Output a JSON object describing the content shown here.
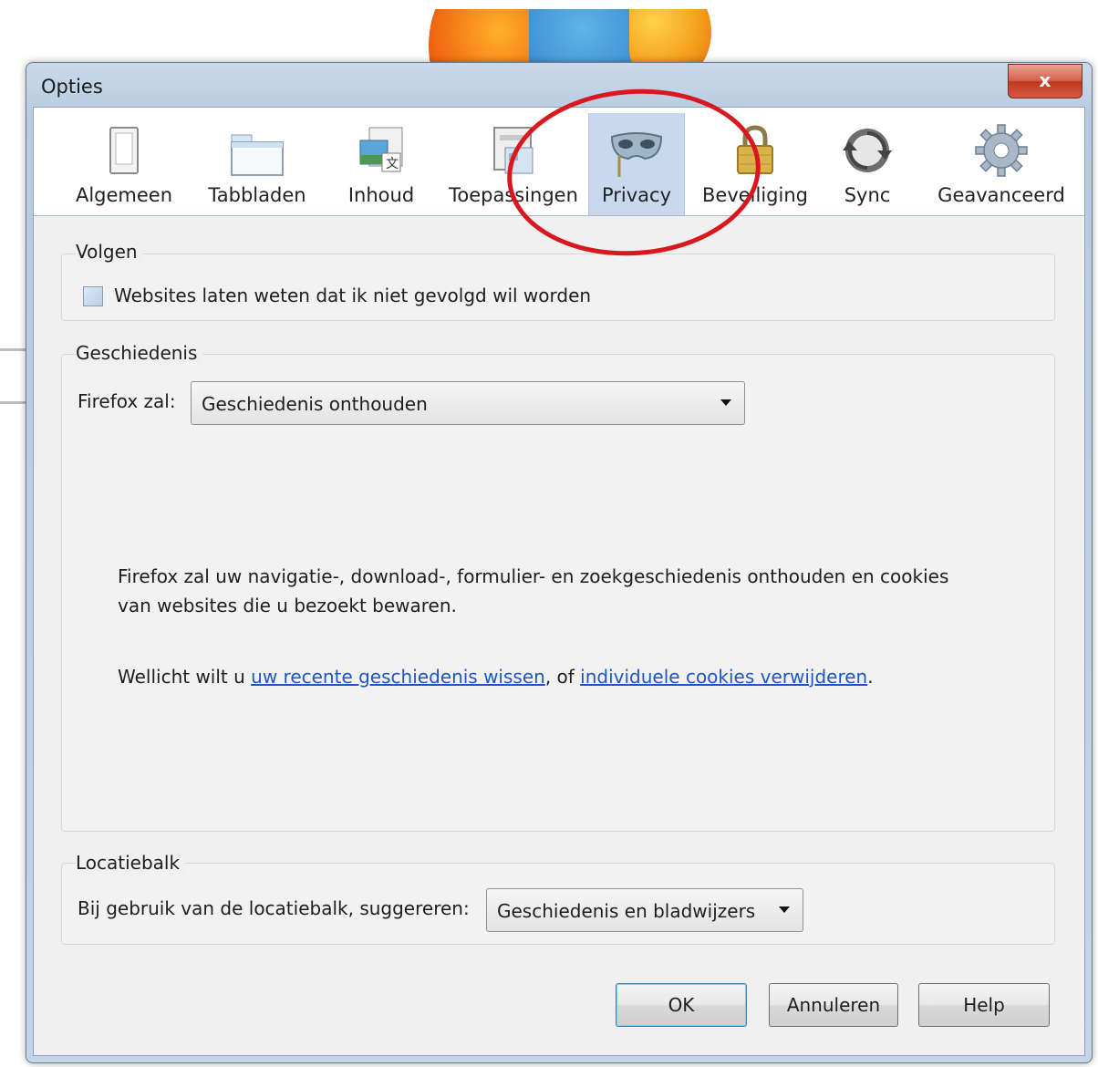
{
  "window": {
    "title": "Opties",
    "close_label": "x"
  },
  "toolbar": {
    "tabs": [
      {
        "label": "Algemeen",
        "icon": "switch-icon"
      },
      {
        "label": "Tabbladen",
        "icon": "tabs-window-icon"
      },
      {
        "label": "Inhoud",
        "icon": "content-icon"
      },
      {
        "label": "Toepassingen",
        "icon": "applications-icon"
      },
      {
        "label": "Privacy",
        "icon": "mask-icon",
        "selected": true
      },
      {
        "label": "Beveiliging",
        "icon": "padlock-icon"
      },
      {
        "label": "Sync",
        "icon": "sync-icon"
      },
      {
        "label": "Geavanceerd",
        "icon": "gear-icon"
      }
    ]
  },
  "tracking": {
    "title": "Volgen",
    "dnt_label": "Websites laten weten dat ik niet gevolgd wil worden",
    "dnt_checked": false
  },
  "history": {
    "title": "Geschiedenis",
    "mode_label": "Firefox zal:",
    "mode_value": "Geschiedenis onthouden",
    "description_line1": "Firefox zal uw navigatie-, download-, formulier- en zoekgeschiedenis onthouden en cookies",
    "description_line2": "van websites die u bezoekt bewaren.",
    "hint_prefix": "Wellicht wilt u ",
    "clear_link": "uw recente geschiedenis wissen",
    "hint_middle": ", of ",
    "cookies_link": "individuele cookies verwijderen",
    "hint_suffix": "."
  },
  "locationbar": {
    "title": "Locatiebalk",
    "suggest_label": "Bij gebruik van de locatiebalk, suggereren:",
    "suggest_value": "Geschiedenis en bladwijzers"
  },
  "buttons": {
    "ok": "OK",
    "cancel": "Annuleren",
    "help": "Help"
  },
  "colors": {
    "accent_link": "#1c57c7",
    "annotation": "#d8181e",
    "selected_tab": "#c7d8ef"
  }
}
